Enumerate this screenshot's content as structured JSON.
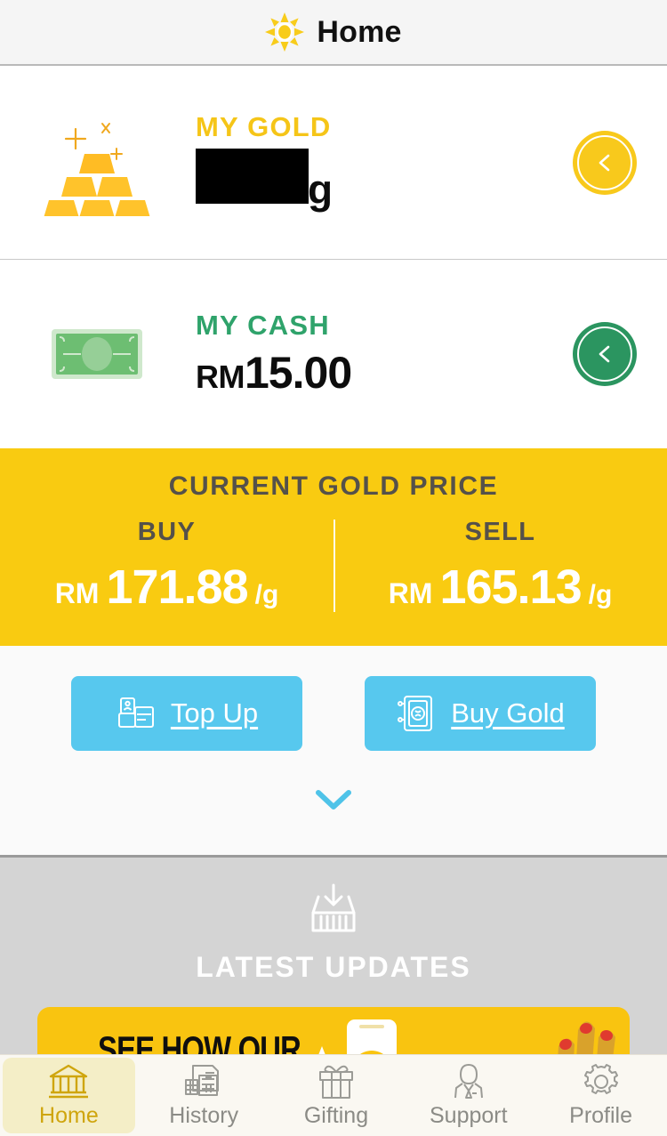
{
  "header": {
    "title": "Home",
    "logo_icon": "sun-icon"
  },
  "balances": {
    "gold": {
      "label": "MY GOLD",
      "icon": "gold-bars-icon",
      "value": "",
      "value_redacted": true,
      "unit": "g",
      "action_icon": "chevron-left-icon",
      "accent_color": "#F5C518"
    },
    "cash": {
      "label": "MY CASH",
      "icon": "banknote-icon",
      "currency": "RM",
      "value": "15.00",
      "action_icon": "chevron-left-icon",
      "accent_color": "#2FA36B"
    }
  },
  "gold_price": {
    "title": "CURRENT GOLD PRICE",
    "background_color": "#F9CB11",
    "buy": {
      "label": "BUY",
      "currency": "RM",
      "value": "171.88",
      "unit": "/g"
    },
    "sell": {
      "label": "SELL",
      "currency": "RM",
      "value": "165.13",
      "unit": "/g"
    }
  },
  "actions": {
    "top_up": {
      "label": "Top Up",
      "icon": "wallet-card-icon"
    },
    "buy_gold": {
      "label": "Buy Gold",
      "icon": "safe-vault-icon"
    },
    "expand_icon": "chevron-down-icon",
    "button_color": "#57C8EE"
  },
  "updates": {
    "title": "LATEST UPDATES",
    "icon": "inbox-tray-icon",
    "promo": {
      "text": "SEE HOW OUR",
      "background_color": "#F9C410",
      "art_icons": [
        "phone-play-icon",
        "tablet-icon",
        "hand-icon"
      ]
    }
  },
  "bottom_nav": {
    "active_index": 0,
    "items": [
      {
        "label": "Home",
        "icon": "bank-icon"
      },
      {
        "label": "History",
        "icon": "documents-calculator-icon"
      },
      {
        "label": "Gifting",
        "icon": "gift-box-icon"
      },
      {
        "label": "Support",
        "icon": "person-suit-icon"
      },
      {
        "label": "Profile",
        "icon": "gear-icon"
      }
    ]
  }
}
